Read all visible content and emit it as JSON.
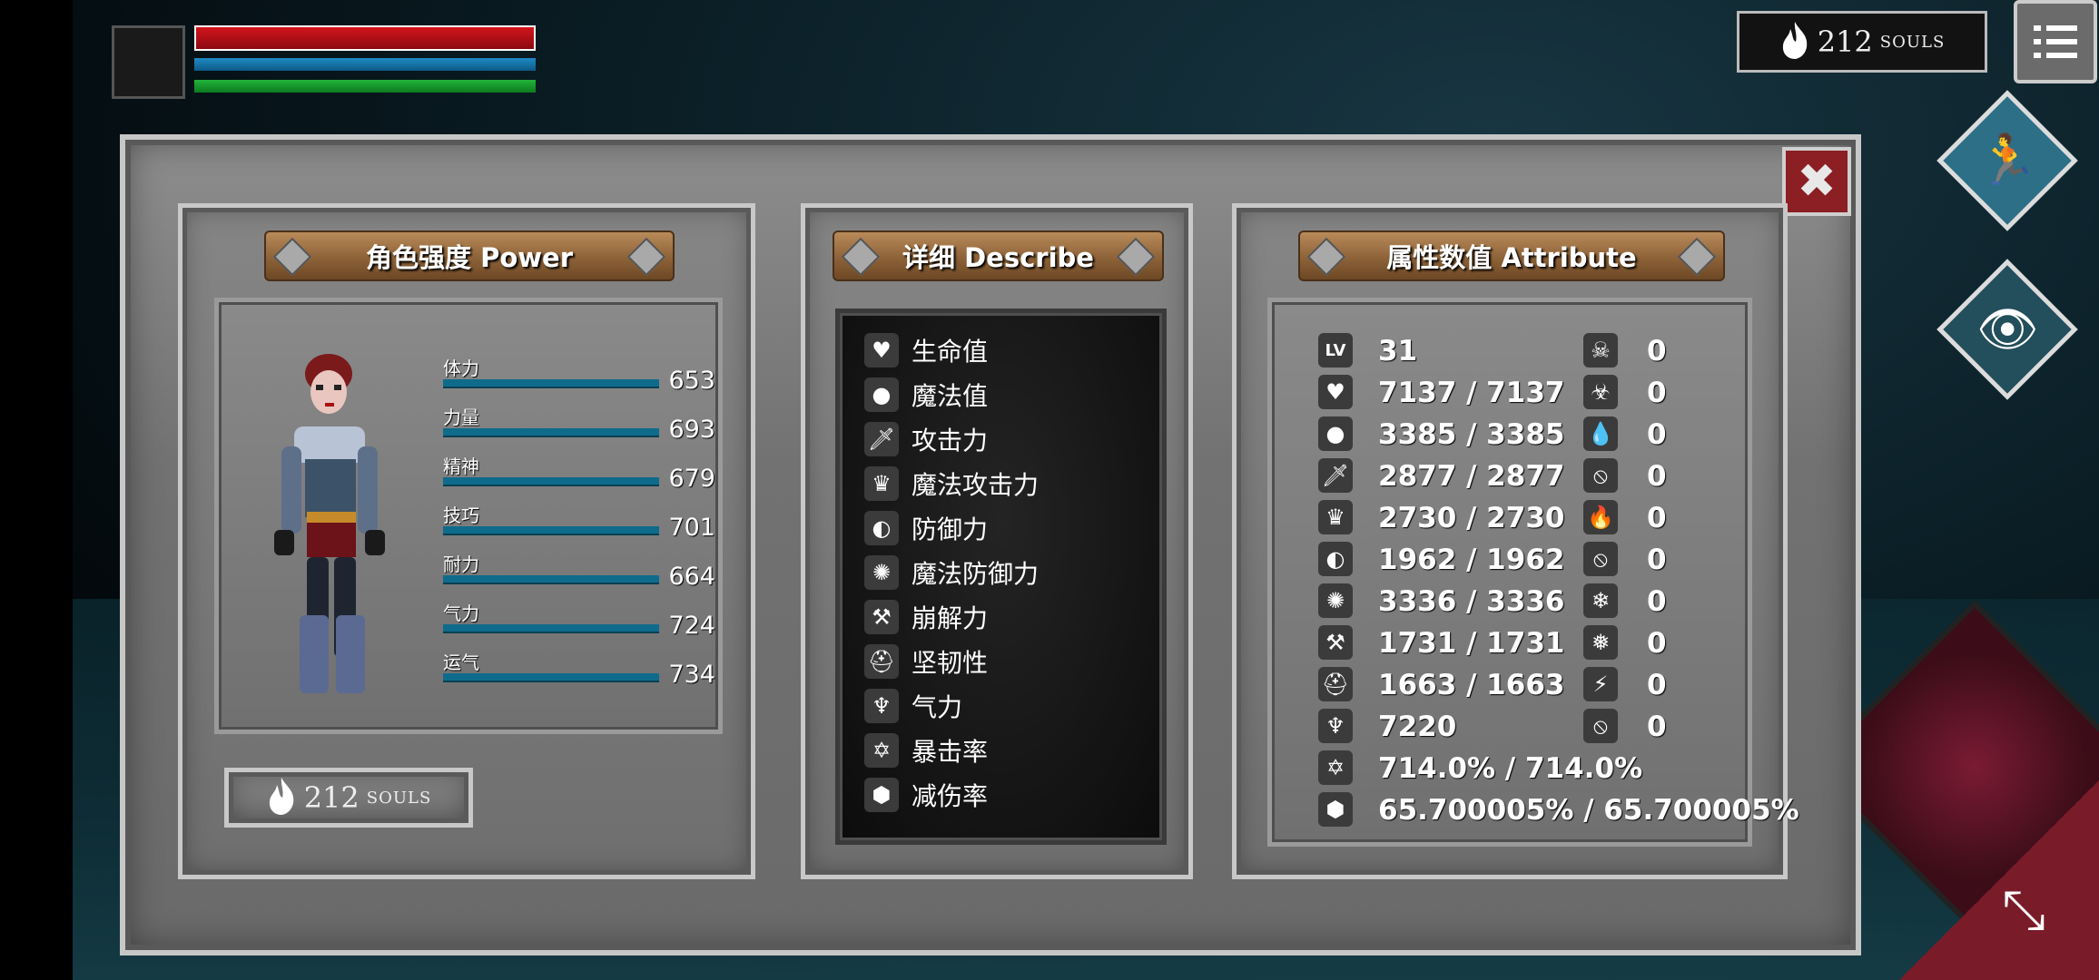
{
  "hud": {
    "souls_value": "212",
    "souls_unit": "SOULS"
  },
  "panels": {
    "power": {
      "title": "角色强度 Power",
      "stats": [
        {
          "label": "体力",
          "value": "653"
        },
        {
          "label": "力量",
          "value": "693"
        },
        {
          "label": "精神",
          "value": "679"
        },
        {
          "label": "技巧",
          "value": "701"
        },
        {
          "label": "耐力",
          "value": "664"
        },
        {
          "label": "气力",
          "value": "724"
        },
        {
          "label": "运气",
          "value": "734"
        }
      ],
      "souls_value": "212",
      "souls_unit": "SOULS"
    },
    "describe": {
      "title": "详细 Describe",
      "items": [
        {
          "label": "生命值",
          "icon": "heart-icon"
        },
        {
          "label": "魔法值",
          "icon": "head-icon"
        },
        {
          "label": "攻击力",
          "icon": "sword-icon"
        },
        {
          "label": "魔法攻击力",
          "icon": "magic-book-icon"
        },
        {
          "label": "防御力",
          "icon": "shield-icon"
        },
        {
          "label": "魔法防御力",
          "icon": "magic-shield-icon"
        },
        {
          "label": "崩解力",
          "icon": "break-icon"
        },
        {
          "label": "坚韧性",
          "icon": "helmet-icon"
        },
        {
          "label": "气力",
          "icon": "lungs-icon"
        },
        {
          "label": "暴击率",
          "icon": "star-icon"
        },
        {
          "label": "减伤率",
          "icon": "badge-icon"
        }
      ]
    },
    "attribute": {
      "title": "属性数值 Attribute",
      "lv_label": "LV",
      "rows": [
        {
          "icon": "level-icon",
          "value": "31",
          "res_icon": "skull-icon",
          "res_value": "0"
        },
        {
          "icon": "heart-icon",
          "value": "7137 / 7137",
          "res_icon": "poison-skull-icon",
          "res_value": "0"
        },
        {
          "icon": "head-icon",
          "value": "3385 / 3385",
          "res_icon": "blood-drop-icon",
          "res_value": "0"
        },
        {
          "icon": "sword-icon",
          "value": "2877 / 2877",
          "res_icon": "bleed-icon",
          "res_value": "0"
        },
        {
          "icon": "magic-book-icon",
          "value": "2730 / 2730",
          "res_icon": "fire-icon",
          "res_value": "0"
        },
        {
          "icon": "shield-icon",
          "value": "1962 / 1962",
          "res_icon": "burn-icon",
          "res_value": "0"
        },
        {
          "icon": "magic-shield-icon",
          "value": "3336 / 3336",
          "res_icon": "snowflake-icon",
          "res_value": "0"
        },
        {
          "icon": "break-icon",
          "value": "1731 / 1731",
          "res_icon": "frost-icon",
          "res_value": "0"
        },
        {
          "icon": "helmet-icon",
          "value": "1663 / 1663",
          "res_icon": "lightning-icon",
          "res_value": "0"
        },
        {
          "icon": "lungs-icon",
          "value": "7220",
          "res_icon": "shock-icon",
          "res_value": "0"
        },
        {
          "icon": "star-icon",
          "value": "714.0% / 714.0%"
        },
        {
          "icon": "badge-icon",
          "value": "65.700005% / 65.700005%"
        }
      ]
    }
  },
  "colors": {
    "hp": "#d3141c",
    "mp": "#1e8ac4",
    "stamina": "#21b43a",
    "close": "#8b1f23"
  }
}
